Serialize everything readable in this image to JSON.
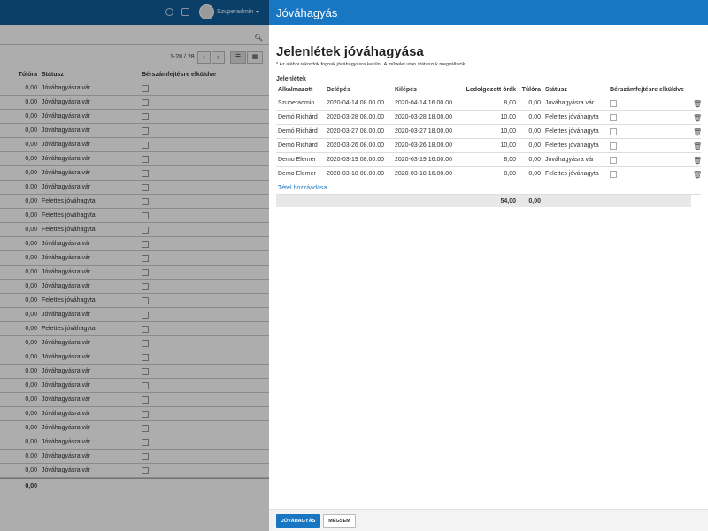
{
  "topbar": {
    "user_name": "Szuperadmin",
    "icons": [
      "help-icon",
      "chat-icon",
      "avatar-icon",
      "caret-down-icon"
    ]
  },
  "background": {
    "pager_text": "1-28 / 28",
    "columns": [
      "Túlóra",
      "Státusz",
      "Bérszámfejtésre elküldve"
    ],
    "rows": [
      {
        "overtime": "0,00",
        "status": "Jóváhagyásra vár"
      },
      {
        "overtime": "0,00",
        "status": "Jóváhagyásra vár"
      },
      {
        "overtime": "0,00",
        "status": "Jóváhagyásra vár"
      },
      {
        "overtime": "0,00",
        "status": "Jóváhagyásra vár"
      },
      {
        "overtime": "0,00",
        "status": "Jóváhagyásra vár"
      },
      {
        "overtime": "0,00",
        "status": "Jóváhagyásra vár"
      },
      {
        "overtime": "0,00",
        "status": "Jóváhagyásra vár"
      },
      {
        "overtime": "0,00",
        "status": "Jóváhagyásra vár"
      },
      {
        "overtime": "0,00",
        "status": "Felettes jóváhagyta"
      },
      {
        "overtime": "0,00",
        "status": "Felettes jóváhagyta"
      },
      {
        "overtime": "0,00",
        "status": "Felettes jóváhagyta"
      },
      {
        "overtime": "0,00",
        "status": "Jóváhagyásra vár"
      },
      {
        "overtime": "0,00",
        "status": "Jóváhagyásra vár"
      },
      {
        "overtime": "0,00",
        "status": "Jóváhagyásra vár"
      },
      {
        "overtime": "0,00",
        "status": "Jóváhagyásra vár"
      },
      {
        "overtime": "0,00",
        "status": "Felettes jóváhagyta"
      },
      {
        "overtime": "0,00",
        "status": "Jóváhagyásra vár"
      },
      {
        "overtime": "0,00",
        "status": "Felettes jóváhagyta"
      },
      {
        "overtime": "0,00",
        "status": "Jóváhagyásra vár"
      },
      {
        "overtime": "0,00",
        "status": "Jóváhagyásra vár"
      },
      {
        "overtime": "0,00",
        "status": "Jóváhagyásra vár"
      },
      {
        "overtime": "0,00",
        "status": "Jóváhagyásra vár"
      },
      {
        "overtime": "0,00",
        "status": "Jóváhagyásra vár"
      },
      {
        "overtime": "0,00",
        "status": "Jóváhagyásra vár"
      },
      {
        "overtime": "0,00",
        "status": "Jóváhagyásra vár"
      },
      {
        "overtime": "0,00",
        "status": "Jóváhagyásra vár"
      },
      {
        "overtime": "0,00",
        "status": "Jóváhagyásra vár"
      },
      {
        "overtime": "0,00",
        "status": "Jóváhagyásra vár"
      }
    ],
    "total_overtime": "0,00"
  },
  "panel": {
    "header_title": "Jóváhagyás",
    "page_title": "Jelenlétek jóváhagyása",
    "note": "* Az alábbi rekordok fognak jóváhagyásra kerülni. A művelet után státuszuk megváltozik.",
    "section_title": "Jelenlétek",
    "columns": {
      "employee": "Alkalmazott",
      "clock_in": "Belépés",
      "clock_out": "Kilépés",
      "hours": "Ledolgozott órák",
      "overtime": "Túlóra",
      "status": "Státusz",
      "payroll": "Bérszámfejtésre elküldve"
    },
    "rows": [
      {
        "employee": "Szuperadmin",
        "clock_in": "2020-04-14 08.00.00",
        "clock_out": "2020-04-14 16.00.00",
        "hours": "8,00",
        "overtime": "0,00",
        "status": "Jóváhagyásra vár"
      },
      {
        "employee": "Demó Richárd",
        "clock_in": "2020-03-28 08.00.00",
        "clock_out": "2020-03-28 18.00.00",
        "hours": "10,00",
        "overtime": "0,00",
        "status": "Felettes jóváhagyta"
      },
      {
        "employee": "Demó Richárd",
        "clock_in": "2020-03-27 08.00.00",
        "clock_out": "2020-03-27 18.00.00",
        "hours": "10,00",
        "overtime": "0,00",
        "status": "Felettes jóváhagyta"
      },
      {
        "employee": "Demó Richárd",
        "clock_in": "2020-03-26 08.00.00",
        "clock_out": "2020-03-26 18.00.00",
        "hours": "10,00",
        "overtime": "0,00",
        "status": "Felettes jóváhagyta"
      },
      {
        "employee": "Demo Elemer",
        "clock_in": "2020-03-19 08.00.00",
        "clock_out": "2020-03-19 16.00.00",
        "hours": "8,00",
        "overtime": "0,00",
        "status": "Jóváhagyásra vár"
      },
      {
        "employee": "Demo Elemer",
        "clock_in": "2020-03-18 08.00.00",
        "clock_out": "2020-03-18 16.00.00",
        "hours": "8,00",
        "overtime": "0,00",
        "status": "Felettes jóváhagyta"
      }
    ],
    "add_item_label": "Tétel hozzáadása",
    "total_hours": "54,00",
    "total_overtime": "0,00",
    "approve_label": "JÓVÁHAGYÁS",
    "cancel_label": "MÉGSEM"
  },
  "colors": {
    "topbar_bg": "#0f5e9c",
    "panel_header_bg": "#1976c2",
    "primary_button": "#1976c2",
    "link": "#1976c2"
  }
}
